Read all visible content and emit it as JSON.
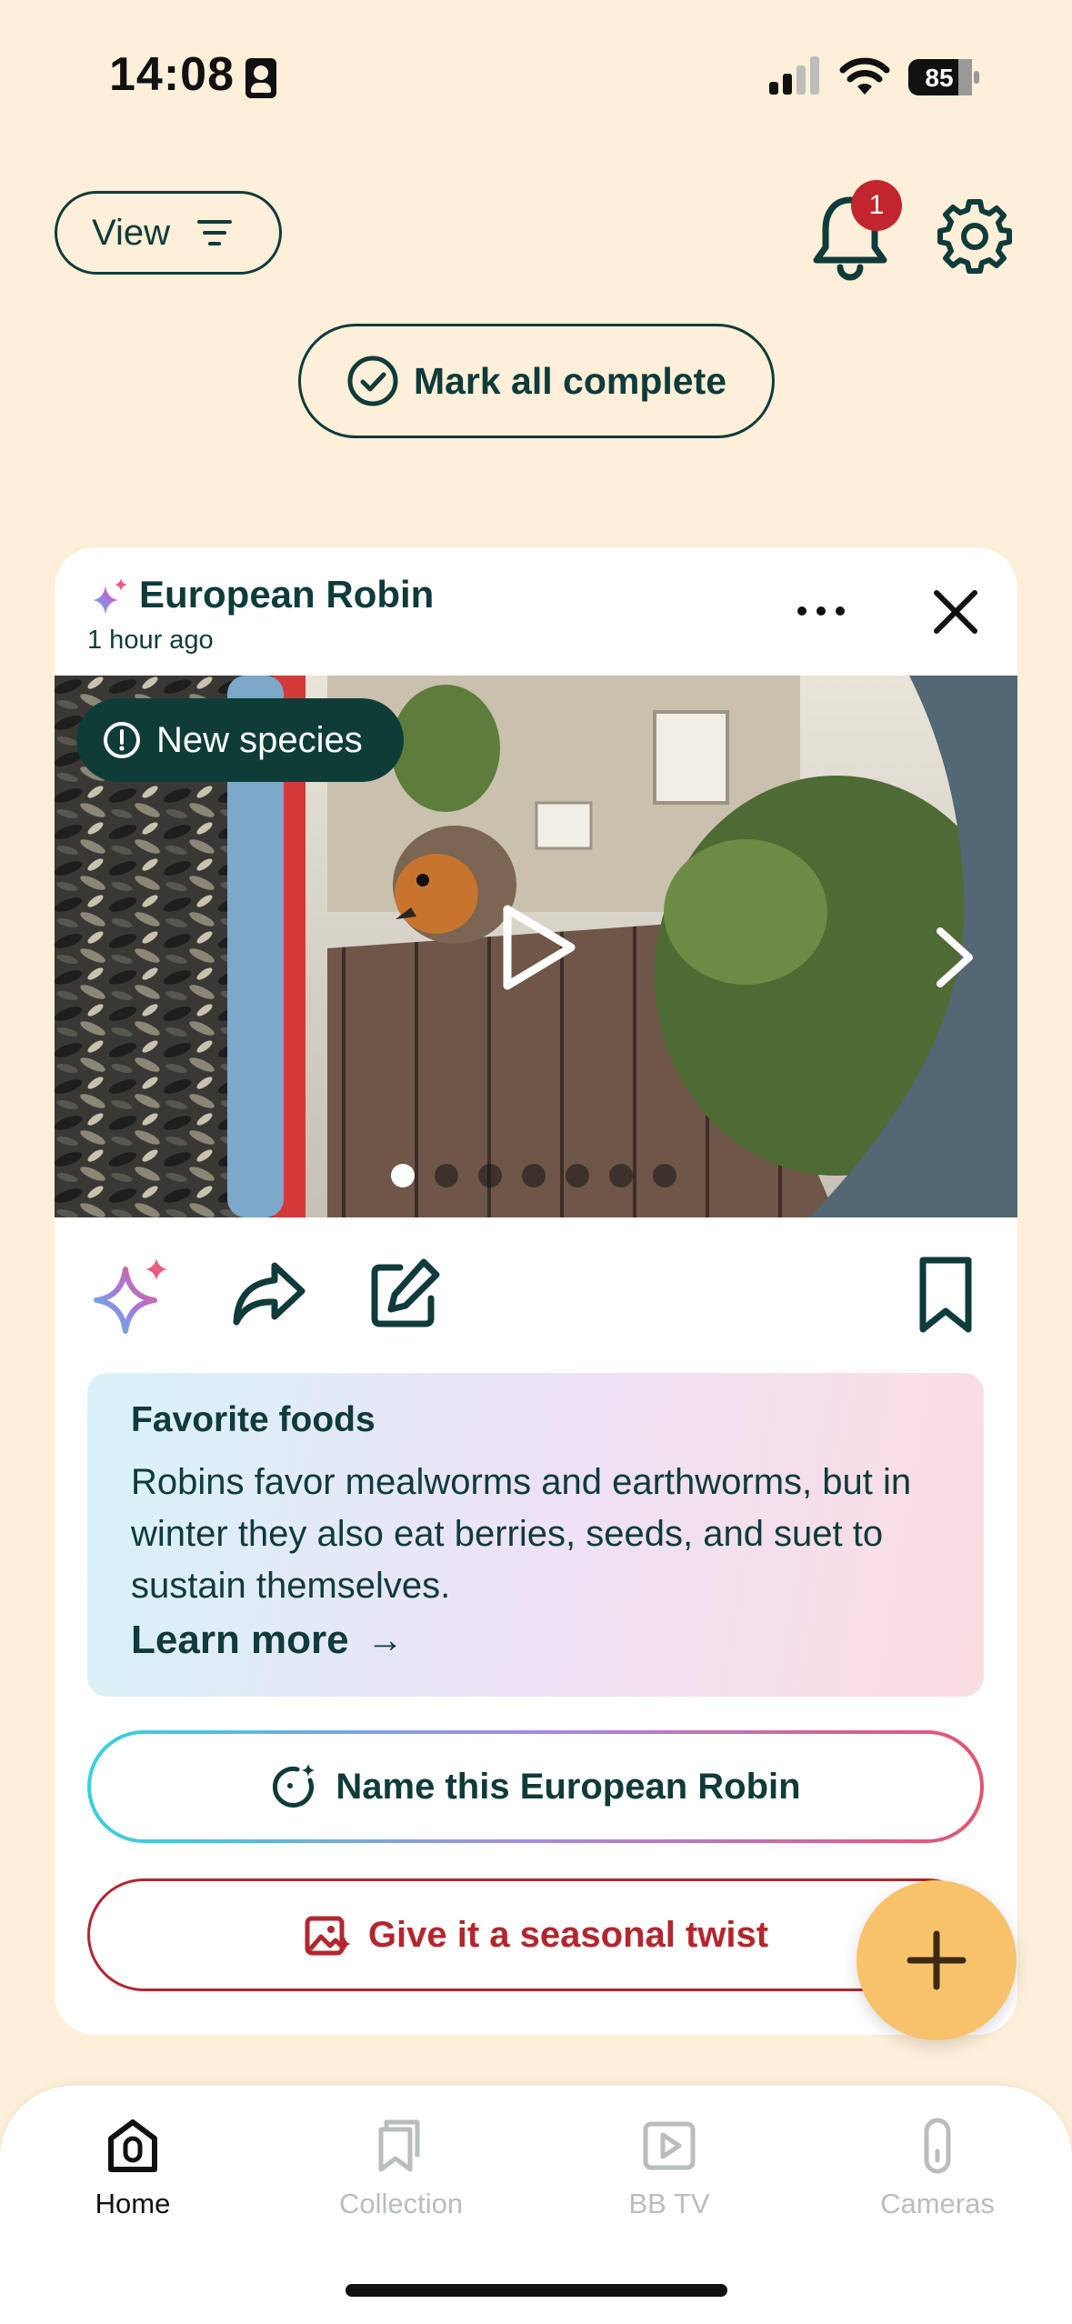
{
  "status_bar": {
    "time": "14:08",
    "battery": "85",
    "icons": [
      "contact-card-icon",
      "signal-icon",
      "wifi-icon",
      "battery-icon"
    ]
  },
  "header": {
    "view_label": "View",
    "notification_count": "1",
    "mark_all_label": "Mark all complete"
  },
  "card": {
    "title": "European Robin",
    "time_ago": "1 hour ago",
    "badge_label": "New species",
    "carousel": {
      "total": 7,
      "current": 1
    },
    "info": {
      "title": "Favorite foods",
      "body": "Robins favor mealworms and earthworms, but in winter they also eat berries, seeds, and suet to sustain themselves.",
      "link": "Learn more"
    },
    "name_button": "Name this European Robin",
    "twist_button": "Give it a seasonal twist"
  },
  "nav": {
    "items": [
      {
        "label": "Home",
        "icon": "home-icon",
        "active": true
      },
      {
        "label": "Collection",
        "icon": "collection-icon",
        "active": false
      },
      {
        "label": "BB TV",
        "icon": "tv-icon",
        "active": false
      },
      {
        "label": "Cameras",
        "icon": "camera-icon",
        "active": false
      }
    ]
  },
  "colors": {
    "background": "#FDEFD8",
    "primary": "#0F3B3A",
    "badge_red": "#C2252D",
    "twist_red": "#B3262D",
    "fab": "#F8C26A",
    "nav_inactive": "#B9BDBD"
  }
}
